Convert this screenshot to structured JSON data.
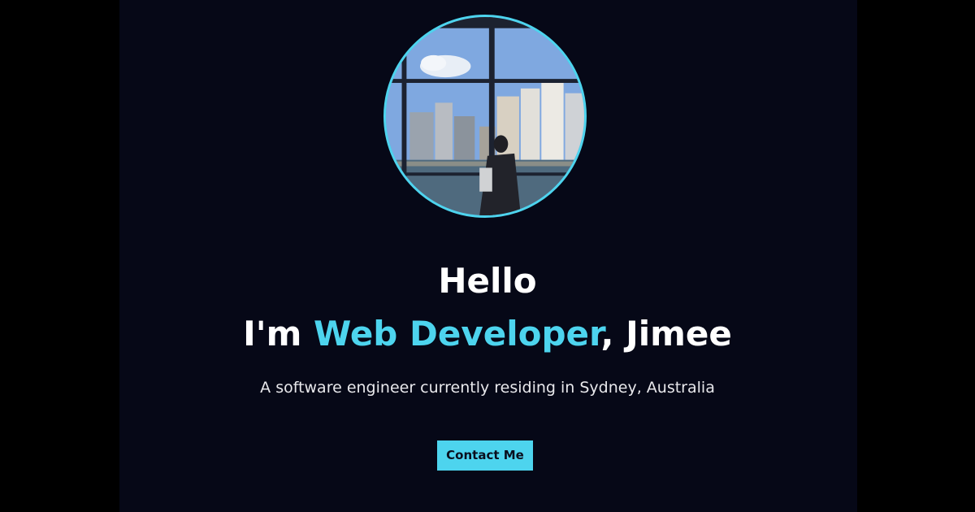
{
  "hero": {
    "greeting": "Hello",
    "headline_prefix": "I'm ",
    "headline_role": "Web Developer",
    "headline_suffix": ", Jimee",
    "subtitle": "A software engineer currently residing in Sydney, Australia",
    "contact_label": "Contact Me"
  },
  "colors": {
    "accent": "#4dd4ee",
    "background": "#060817",
    "text": "#ffffff"
  }
}
